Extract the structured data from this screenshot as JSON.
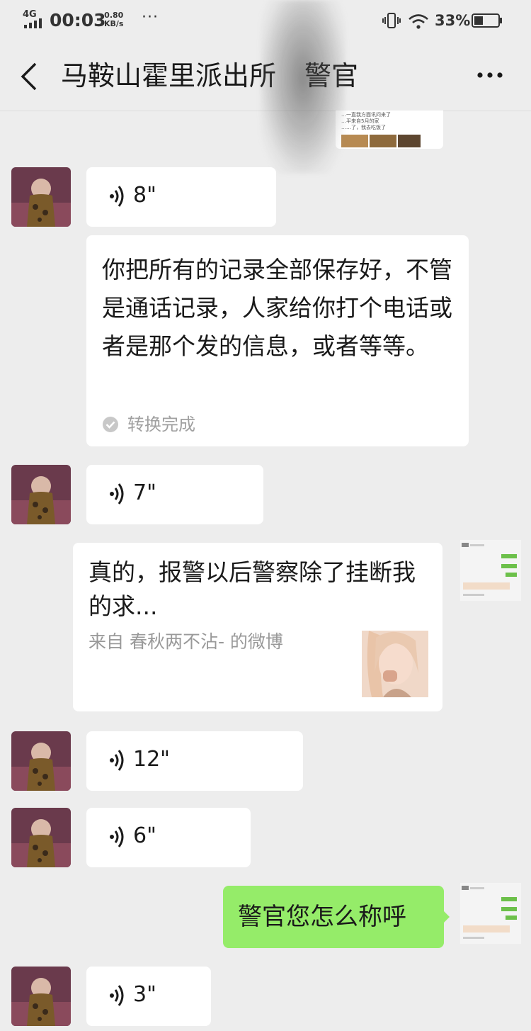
{
  "status_bar": {
    "network": "4G",
    "time": "00:03",
    "speed_value": "0.80",
    "speed_unit": "KB/s",
    "more": "···",
    "battery": "33%"
  },
  "chat": {
    "title": "马鞍山霍里派出所",
    "title_tail": "警官"
  },
  "top_preview_lines": [
    "…一直我方面讯问来了",
    "…平来自5月的家",
    "……了，我去吃饭了"
  ],
  "messages": [
    {
      "type": "voice",
      "side": "left",
      "duration": "8\""
    },
    {
      "type": "transcript",
      "side": "left",
      "text": "你把所有的记录全部保存好，不管是通话记录，人家给你打个电话或者是那个发的信息，或者等等。",
      "status": "转换完成"
    },
    {
      "type": "voice",
      "side": "left",
      "duration": "7\""
    },
    {
      "type": "link-card",
      "side": "right",
      "title": "真的，报警以后警察除了挂断我的求...",
      "source": "来自 春秋两不沾- 的微博"
    },
    {
      "type": "voice",
      "side": "left",
      "duration": "12\""
    },
    {
      "type": "voice",
      "side": "left",
      "duration": "6\""
    },
    {
      "type": "text",
      "side": "right",
      "text": "警官您怎么称呼"
    },
    {
      "type": "voice",
      "side": "left",
      "duration": "3\""
    }
  ],
  "colors": {
    "background": "#ededed",
    "bubble_left": "#ffffff",
    "bubble_right": "#95ec69",
    "text": "#1a1a1a",
    "muted": "#999999"
  }
}
